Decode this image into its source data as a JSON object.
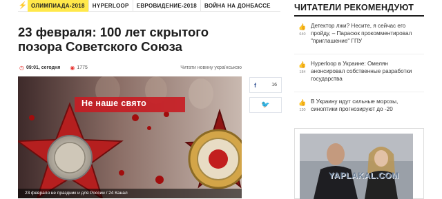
{
  "nav": {
    "items": [
      {
        "label": "ОЛИМПИАДА-2018"
      },
      {
        "label": "HYPERLOOP"
      },
      {
        "label": "ЕВРОВИДЕНИЕ-2018"
      },
      {
        "label": "ВОЙНА НА ДОНБАССЕ"
      }
    ]
  },
  "article": {
    "title": "23 февраля: 100 лет скрытого позора Советского Союза",
    "time": "09:01, сегодня",
    "views": "1775",
    "read_in_ukrainian": "Читати новину українською",
    "image_banner": "Не наше свято",
    "image_caption": "23 февраля не праздник и для России / 24 Канал"
  },
  "share": {
    "facebook_count": "16"
  },
  "sidebar": {
    "title": "ЧИТАТЕЛИ РЕКОМЕНДУЮТ",
    "items": [
      {
        "likes": "640",
        "text": "Детектор лжи? Несите, я сейчас его пройду, – Парасюк прокомментировал \"приглашение\" ГПУ"
      },
      {
        "likes": "184",
        "text": "Hyperloop в Украине: Омелян анонсировал собственные разработки государства"
      },
      {
        "likes": "130",
        "text": "В Украину идут сильные морозы, синоптики прогнозируют до -20"
      }
    ]
  },
  "watermark": "YAPLAKAL.COM",
  "colors": {
    "accent_red": "#e8322f",
    "nav_active": "#ffe84a",
    "facebook": "#3b5998",
    "twitter": "#55acee"
  }
}
